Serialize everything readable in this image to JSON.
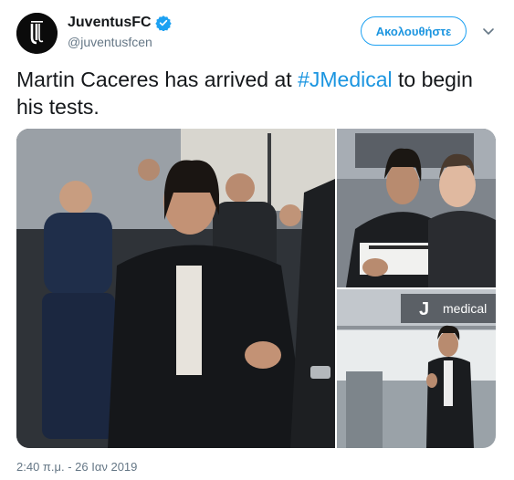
{
  "account": {
    "display_name": "JuventusFC",
    "handle": "@juventusfcen",
    "verified": true,
    "avatar_icon": "juventus-logo-icon"
  },
  "follow_button": {
    "label": "Ακολουθήστε"
  },
  "more_menu_icon": "chevron-down-icon",
  "tweet": {
    "text_before": "Martin Caceres has arrived at ",
    "hashtag": "#JMedical",
    "text_after": " to begin his tests."
  },
  "media": {
    "photos": [
      {
        "name": "arrival-crowd-photo"
      },
      {
        "name": "signing-autograph-photo"
      },
      {
        "name": "medical-building-photo",
        "sign_text": "medical"
      }
    ]
  },
  "timestamp": "2:40 π.μ. - 26 Ιαν 2019",
  "colors": {
    "link": "#1b95e0",
    "text": "#14171a",
    "secondary": "#657786",
    "verified": "#1da1f2"
  }
}
